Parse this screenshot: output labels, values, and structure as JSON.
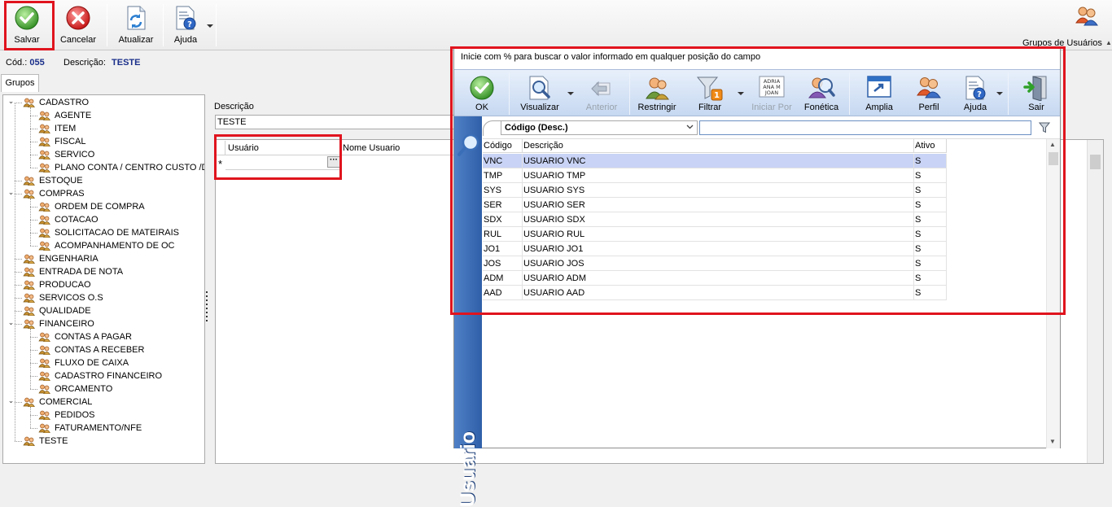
{
  "toolbar": {
    "buttons": [
      {
        "id": "salvar",
        "label": "Salvar",
        "icon": "check-circle-icon"
      },
      {
        "id": "cancelar",
        "label": "Cancelar",
        "icon": "cancel-x-icon"
      },
      {
        "id": "atualizar",
        "label": "Atualizar",
        "icon": "refresh-document-icon"
      },
      {
        "id": "ajuda",
        "label": "Ajuda",
        "icon": "help-document-icon"
      }
    ],
    "right_label": "Grupos de Usuários"
  },
  "header": {
    "cod_label": "Cód.:",
    "cod_value": "055",
    "descricao_label": "Descrição:",
    "descricao_value": "TESTE"
  },
  "tabs": [
    "Grupos"
  ],
  "tree": [
    {
      "label": "CADASTRO",
      "level": 0,
      "expanded": true
    },
    {
      "label": "AGENTE",
      "level": 1
    },
    {
      "label": "ITEM",
      "level": 1
    },
    {
      "label": "FISCAL",
      "level": 1
    },
    {
      "label": "SERVICO",
      "level": 1
    },
    {
      "label": "PLANO CONTA / CENTRO CUSTO /DEF",
      "level": 1
    },
    {
      "label": "ESTOQUE",
      "level": 0
    },
    {
      "label": "COMPRAS",
      "level": 0,
      "expanded": true
    },
    {
      "label": "ORDEM DE COMPRA",
      "level": 1
    },
    {
      "label": "COTACAO",
      "level": 1
    },
    {
      "label": "SOLICITACAO DE MATEIRAIS",
      "level": 1
    },
    {
      "label": "ACOMPANHAMENTO DE OC",
      "level": 1
    },
    {
      "label": "ENGENHARIA",
      "level": 0
    },
    {
      "label": "ENTRADA DE NOTA",
      "level": 0
    },
    {
      "label": "PRODUCAO",
      "level": 0
    },
    {
      "label": "SERVICOS O.S",
      "level": 0
    },
    {
      "label": "QUALIDADE",
      "level": 0
    },
    {
      "label": "FINANCEIRO",
      "level": 0,
      "expanded": true
    },
    {
      "label": "CONTAS A PAGAR",
      "level": 1
    },
    {
      "label": "CONTAS A RECEBER",
      "level": 1
    },
    {
      "label": "FLUXO DE CAIXA",
      "level": 1
    },
    {
      "label": "CADASTRO FINANCEIRO",
      "level": 1
    },
    {
      "label": "ORCAMENTO",
      "level": 1
    },
    {
      "label": "COMERCIAL",
      "level": 0,
      "expanded": true
    },
    {
      "label": "PEDIDOS",
      "level": 1
    },
    {
      "label": "FATURAMENTO/NFE",
      "level": 1
    },
    {
      "label": "TESTE",
      "level": 0
    }
  ],
  "form": {
    "descricao_label": "Descrição",
    "descricao_value": "TESTE",
    "grid_columns": [
      "Usuário",
      "Nome Usuario"
    ],
    "new_row_marker": "*",
    "ellipsis": "···"
  },
  "dialog": {
    "hint": "Inicie com % para buscar o valor informado em qualquer posição do campo",
    "side_title": "Usuario",
    "toolbar": [
      {
        "id": "ok",
        "label": "OK",
        "icon": "check-circle-icon",
        "enabled": true
      },
      {
        "id": "visualizar",
        "label": "Visualizar",
        "icon": "magnifier-document-icon",
        "enabled": true,
        "dropdown": true
      },
      {
        "id": "anterior",
        "label": "Anterior",
        "icon": "back-arrow-icon",
        "enabled": false
      },
      {
        "id": "restringir",
        "label": "Restringir",
        "icon": "restrict-users-icon",
        "enabled": true
      },
      {
        "id": "filtrar",
        "label": "Filtrar",
        "icon": "funnel-icon",
        "enabled": true,
        "dropdown": true,
        "badge": "1"
      },
      {
        "id": "iniciar_por",
        "label": "Iniciar Por",
        "icon": "text-list-icon",
        "enabled": false,
        "icon_text": [
          "ADRIA",
          "ANA M",
          "JOAN"
        ]
      },
      {
        "id": "fonetica",
        "label": "Fonética",
        "icon": "phonetic-search-icon",
        "enabled": true
      },
      {
        "id": "amplia",
        "label": "Amplia",
        "icon": "maximize-window-icon",
        "enabled": true
      },
      {
        "id": "perfil",
        "label": "Perfil",
        "icon": "profile-users-icon",
        "enabled": true
      },
      {
        "id": "ajuda",
        "label": "Ajuda",
        "icon": "help-document-icon",
        "enabled": true,
        "dropdown": true
      },
      {
        "id": "sair",
        "label": "Sair",
        "icon": "exit-door-icon",
        "enabled": true
      }
    ],
    "filter_select": "Código (Desc.)",
    "filter_value": "",
    "columns": [
      "Código",
      "Descrição",
      "Ativo"
    ],
    "rows": [
      {
        "codigo": "VNC",
        "descricao": "USUARIO VNC",
        "ativo": "S",
        "selected": true
      },
      {
        "codigo": "TMP",
        "descricao": "USUARIO TMP",
        "ativo": "S"
      },
      {
        "codigo": "SYS",
        "descricao": "USUARIO SYS",
        "ativo": "S"
      },
      {
        "codigo": "SER",
        "descricao": "USUARIO SER",
        "ativo": "S"
      },
      {
        "codigo": "SDX",
        "descricao": "USUARIO SDX",
        "ativo": "S"
      },
      {
        "codigo": "RUL",
        "descricao": "USUARIO RUL",
        "ativo": "S"
      },
      {
        "codigo": "JO1",
        "descricao": "USUARIO JO1",
        "ativo": "S"
      },
      {
        "codigo": "JOS",
        "descricao": "USUARIO JOS",
        "ativo": "S"
      },
      {
        "codigo": "ADM",
        "descricao": "USUARIO ADM",
        "ativo": "S"
      },
      {
        "codigo": "AAD",
        "descricao": "USUARIO AAD",
        "ativo": "S"
      }
    ]
  },
  "colors": {
    "highlight_red": "#e0141e",
    "header_blue": "#1a2f8a",
    "selection": "#c8d3f5",
    "side_band": "#3a6cb5"
  }
}
